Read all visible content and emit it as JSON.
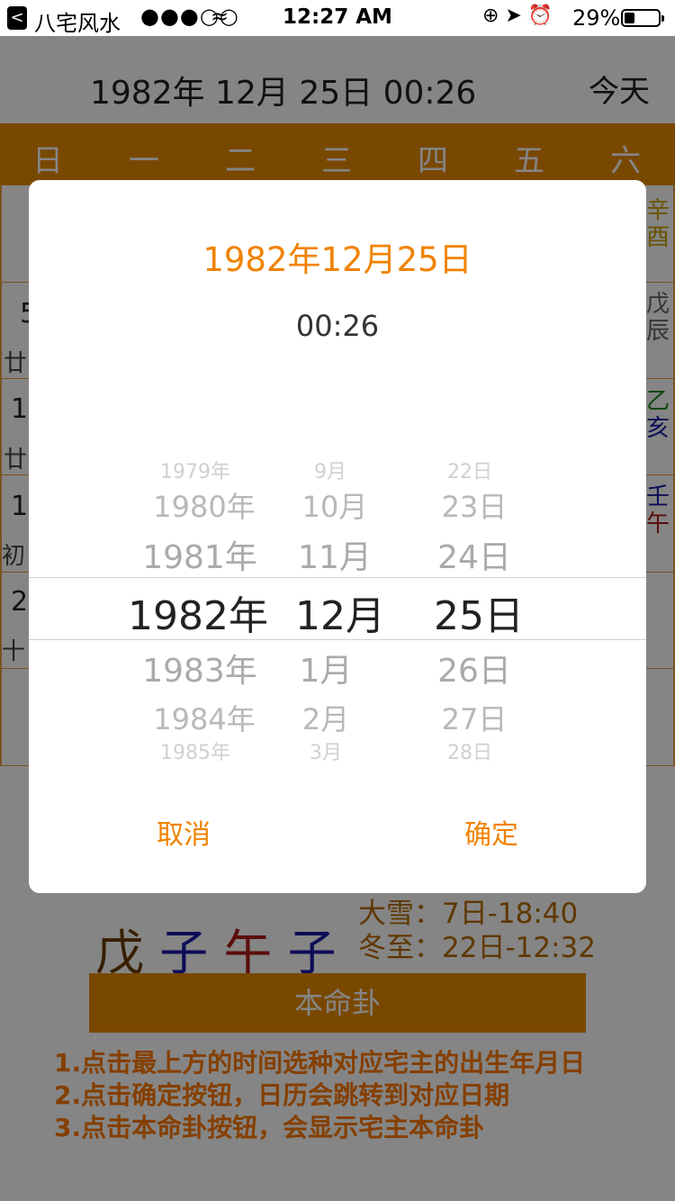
{
  "status_bar": {
    "back": "<",
    "carrier": "八宅风水",
    "signal": "●●●○○",
    "wifi": "≈",
    "time": "12:27 AM",
    "icons": "⊕ ➤ ⏰",
    "battery": "29%"
  },
  "header": {
    "date": "1982年 12月 25日 00:26",
    "today": "今天"
  },
  "weekdays": [
    "日",
    "一",
    "二",
    "三",
    "四",
    "五",
    "六"
  ],
  "calendar": {
    "row1": {
      "right_gz": [
        "辛",
        "酉"
      ]
    },
    "row2": {
      "left_day": "5",
      "left_lunar": "廿",
      "right_gz": [
        "戊",
        "辰"
      ]
    },
    "row3": {
      "left_day": "1",
      "left_lunar": "廿",
      "right_gz": [
        "乙",
        "亥"
      ]
    },
    "row4": {
      "left_day": "1",
      "left_lunar": "初",
      "right_gz": [
        "壬",
        "午"
      ]
    },
    "row5": {
      "left_day": "2",
      "left_lunar": "十"
    }
  },
  "bazi": [
    "戊",
    "子",
    "午",
    "子"
  ],
  "jieqi": [
    "大雪：7日-18:40",
    "冬至：22日-12:32"
  ],
  "benming_button": "本命卦",
  "instructions": [
    "1.点击最上方的时间选种对应宅主的出生年月日",
    "2.点击确定按钮，日历会跳转到对应日期",
    "3.点击本命卦按钮，会显示宅主本命卦"
  ],
  "dialog": {
    "date": "1982年12月25日",
    "time": "00:26",
    "picker": {
      "years": [
        "1979年",
        "1980年",
        "1981年",
        "1982年",
        "1983年",
        "1984年",
        "1985年"
      ],
      "months": [
        "9月",
        "10月",
        "11月",
        "12月",
        "1月",
        "2月",
        "3月"
      ],
      "days": [
        "22日",
        "23日",
        "24日",
        "25日",
        "26日",
        "27日",
        "28日"
      ]
    },
    "cancel": "取消",
    "confirm": "确定"
  },
  "colors": {
    "accent": "#e88a00",
    "dialog_accent": "#f08300",
    "instruction": "#ff7a00",
    "gz_yellow": "#c8a000",
    "gz_green": "#1a8a1a",
    "gz_blue": "#1a1aa8",
    "gz_red": "#b01a1a",
    "gz_gray": "#666666"
  }
}
